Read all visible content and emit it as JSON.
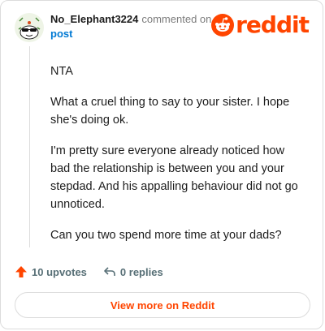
{
  "comment": {
    "username": "No_Elephant3224",
    "action": "commented on",
    "target": "post",
    "avatar_icon": "snoo-sunglasses-avatar-icon",
    "paragraphs": [
      "NTA",
      "What a cruel thing to say to your sister. I hope she's doing ok.",
      "I'm pretty sure everyone already noticed how bad the relationship is between you and your stepdad. And his appalling behaviour did not go unnoticed.",
      "Can you two spend more time at your dads?"
    ]
  },
  "brand": {
    "name": "reddit",
    "icon": "reddit-snoo-icon",
    "color": "#ff4500"
  },
  "stats": {
    "upvotes": "10 upvotes",
    "upvote_icon": "upvote-arrow-icon",
    "replies": "0 replies",
    "reply_icon": "reply-arrow-icon"
  },
  "cta": {
    "label": "View more on Reddit"
  }
}
